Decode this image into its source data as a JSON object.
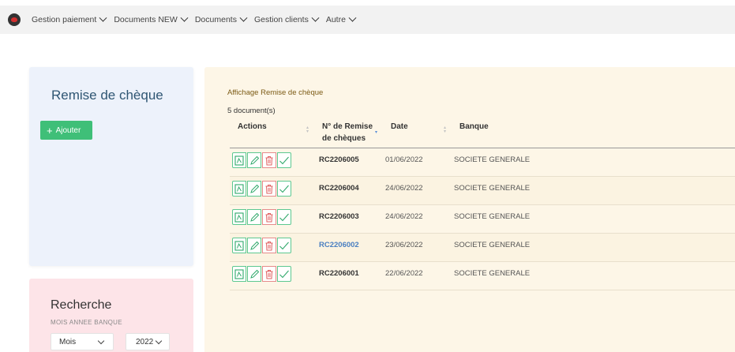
{
  "nav": {
    "items": [
      {
        "label": "Gestion paiement"
      },
      {
        "label": "Documents NEW"
      },
      {
        "label": "Documents"
      },
      {
        "label": "Gestion clients"
      },
      {
        "label": "Autre"
      }
    ]
  },
  "left_panel": {
    "title": "Remise de chèque",
    "add_button": "Ajouter"
  },
  "search_panel": {
    "title": "Recherche",
    "subtitle": "MOIS ANNEE BANQUE",
    "month_select": "Mois",
    "year_select": "2022"
  },
  "main": {
    "title": "Affichage Remise de chèque",
    "count": "5 document(s)",
    "columns": {
      "actions": "Actions",
      "number_line1": "N° de Remise",
      "number_line2": "de chèques",
      "date": "Date",
      "bank": "Banque"
    },
    "rows": [
      {
        "number": "RC2206005",
        "date": "01/06/2022",
        "bank": "SOCIETE GENERALE"
      },
      {
        "number": "RC2206004",
        "date": "24/06/2022",
        "bank": "SOCIETE GENERALE"
      },
      {
        "number": "RC2206003",
        "date": "24/06/2022",
        "bank": "SOCIETE GENERALE"
      },
      {
        "number": "RC2206002",
        "date": "23/06/2022",
        "bank": "SOCIETE GENERALE"
      },
      {
        "number": "RC2206001",
        "date": "22/06/2022",
        "bank": "SOCIETE GENERALE"
      }
    ]
  },
  "icons": {
    "pdf": "pdf-icon",
    "edit": "pencil-icon",
    "delete": "trash-icon",
    "validate": "check-icon"
  },
  "colors": {
    "accent_green": "#3fbf78",
    "delete_red": "#e06060",
    "link_blue": "#4a7fc1"
  }
}
